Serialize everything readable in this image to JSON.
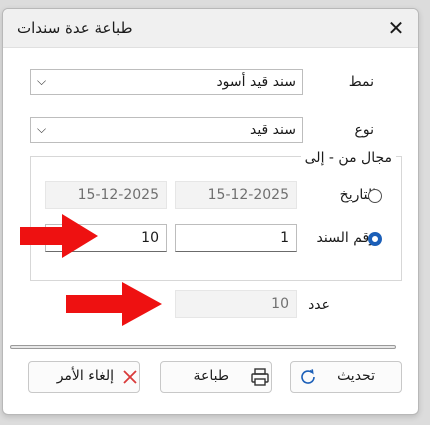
{
  "window": {
    "title": "طباعة عدة سندات",
    "close_icon": "close-icon"
  },
  "form": {
    "style_label": "نمط",
    "style_value": "سند قيد أسود",
    "type_label": "نوع",
    "type_value": "سند قيد",
    "range_group_title": "مجال من - إلى",
    "date_label": "التاريخ",
    "date_from": "15-12-2025",
    "date_to": "15-12-2025",
    "doc_number_label": "رقم السند",
    "doc_from": "1",
    "doc_to": "10",
    "count_label": "عدد",
    "count_value": "10",
    "selected_range_option": "doc_number"
  },
  "buttons": {
    "refresh_label": "تحديث",
    "print_label": "طباعة",
    "cancel_label": "إلغاء الأمر"
  },
  "colors": {
    "accent": "#1b5fb8",
    "annotation_arrow": "#ee1111",
    "cancel_icon": "#d93a3a"
  },
  "annotations": [
    {
      "type": "arrow",
      "points_to": "doc-number-to-field"
    },
    {
      "type": "arrow",
      "points_to": "count-field"
    }
  ]
}
